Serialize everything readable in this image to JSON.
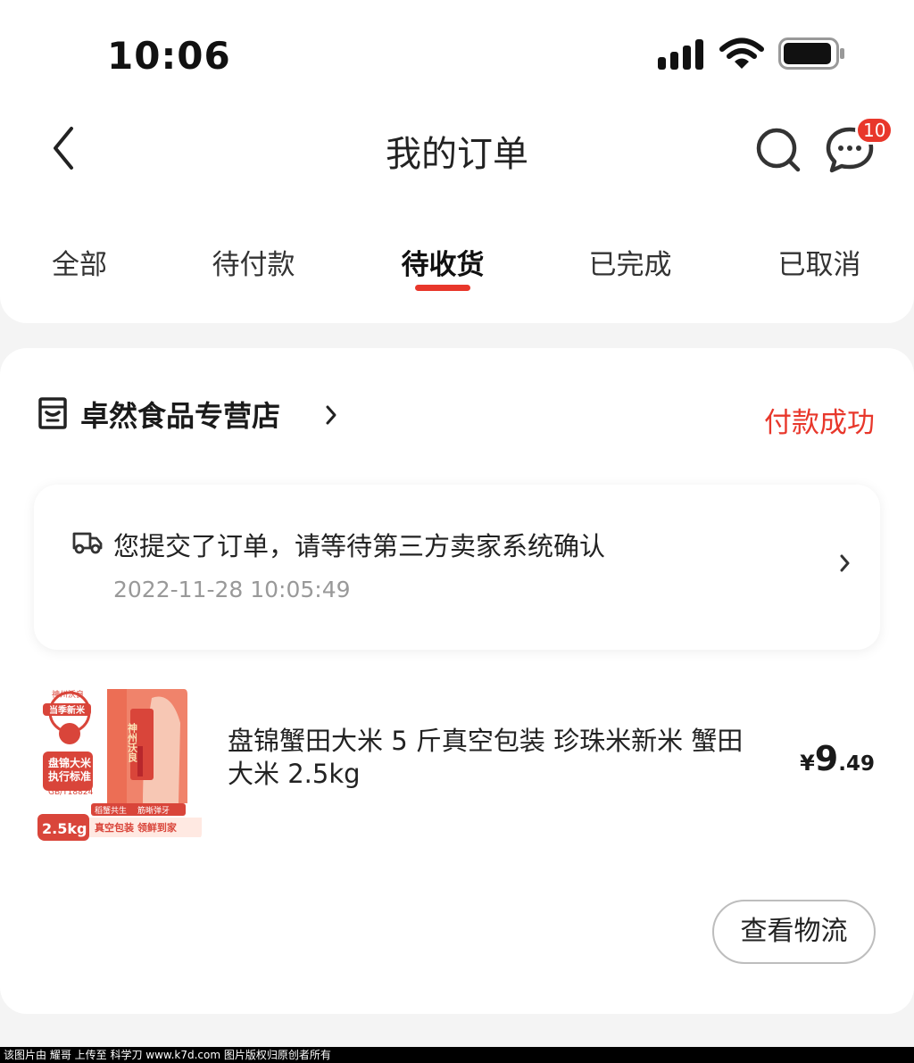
{
  "status_bar": {
    "time": "10:06"
  },
  "nav": {
    "title": "我的订单",
    "message_badge": "10"
  },
  "tabs": [
    {
      "label": "全部"
    },
    {
      "label": "待付款"
    },
    {
      "label": "待收货"
    },
    {
      "label": "已完成"
    },
    {
      "label": "已取消"
    }
  ],
  "active_tab": "待收货",
  "order": {
    "shop_name": "卓然食品专营店",
    "status": "付款成功",
    "notice_text": "您提交了订单，请等待第三方卖家系统确认",
    "notice_time": "2022-11-28 10:05:49",
    "product": {
      "title": "盘锦蟹田大米 5 斤真空包装 珍珠米新米 蟹田大米 2.5kg",
      "price_symbol": "¥",
      "price_integer": "9",
      "price_decimal": ".49",
      "image_text": {
        "brand": "神州沃良",
        "top_badge": "当季新米",
        "label_1": "盘锦大米",
        "label_2": "执行标准",
        "standard": "GB/T18824",
        "weight": "2.5kg",
        "banner_1": "稻蟹共生",
        "banner_2": "筋晰弹牙",
        "banner_3": "真空包装 领鲜到家"
      }
    },
    "logistics_button": "查看物流"
  },
  "footer": {
    "text": "该图片由 耀哥 上传至 科学刀 www.k7d.com 图片版权归原创者所有"
  },
  "colors": {
    "accent": "#e8372b",
    "background": "#f4f4f4",
    "card": "#ffffff"
  }
}
